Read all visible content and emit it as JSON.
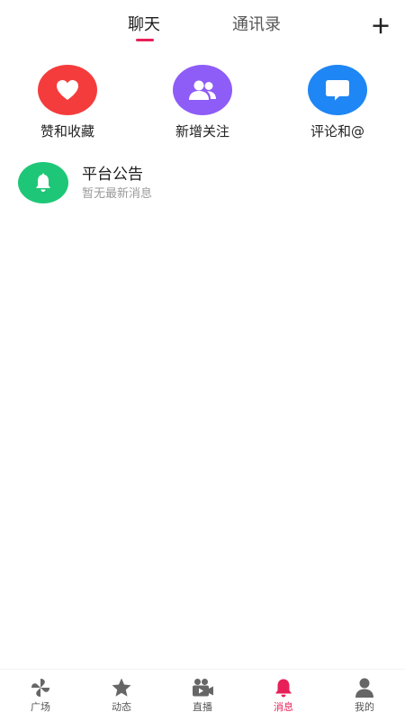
{
  "header": {
    "tabs": [
      {
        "label": "聊天",
        "active": true
      },
      {
        "label": "通讯录",
        "active": false
      }
    ],
    "add_icon": "plus-icon",
    "accent_color": "#e8205a"
  },
  "quick_actions": [
    {
      "label": "赞和收藏",
      "icon": "heart-icon",
      "color": "#f53c3c"
    },
    {
      "label": "新增关注",
      "icon": "users-icon",
      "color": "#8e5cf7"
    },
    {
      "label": "评论和@",
      "icon": "comment-icon",
      "color": "#1e86f5"
    }
  ],
  "announcement": {
    "title": "平台公告",
    "subtitle": "暂无最新消息",
    "icon": "bell-icon",
    "color": "#1ec777"
  },
  "bottom_nav": {
    "active_index": 3,
    "active_color": "#e8205a",
    "inactive_color": "#555555",
    "items": [
      {
        "label": "广场",
        "icon": "pinwheel-icon"
      },
      {
        "label": "动态",
        "icon": "star-icon"
      },
      {
        "label": "直播",
        "icon": "camera-icon"
      },
      {
        "label": "消息",
        "icon": "bell-icon"
      },
      {
        "label": "我的",
        "icon": "person-icon"
      }
    ]
  }
}
